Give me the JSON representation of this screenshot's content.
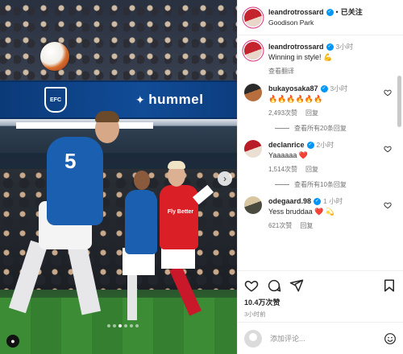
{
  "post": {
    "username": "leandrotrossard",
    "follow_state": "已关注",
    "separator": "•",
    "location": "Goodison Park",
    "photo": {
      "banner_brand": "hummel",
      "crest_text": "EFC",
      "jersey_number": "5",
      "red_shirt_text": "Fly Better",
      "carousel_dots": 6,
      "active_dot": 2
    }
  },
  "caption": {
    "username": "leandrotrossard",
    "time": "3小时",
    "text": "Winning in style! 💪",
    "translate_label": "查看翻译"
  },
  "comments": [
    {
      "username": "bukayosaka87",
      "time": "3小时",
      "text": "🔥🔥🔥🔥🔥🔥",
      "likes": "2,493次赞",
      "reply_label": "回复",
      "view_replies": "查看所有20条回复"
    },
    {
      "username": "declanrice",
      "time": "2小时",
      "text": "Yaaaaaa ❤️",
      "likes": "1,514次赞",
      "reply_label": "回复",
      "view_replies": "查看所有10条回复"
    },
    {
      "username": "odegaard.98",
      "time": "1 小时",
      "text": "Yess bruddaa ❤️ 💫",
      "likes": "621次赞",
      "reply_label": "回复",
      "view_replies": ""
    }
  ],
  "actions": {
    "likes": "10.4万次赞",
    "posted": "3小时前"
  },
  "add_comment": {
    "placeholder": "添加评论..."
  },
  "colors": {
    "verified": "#0095f6",
    "text": "#262626",
    "muted": "#8e8e8e",
    "arsenal_red": "#db1f26",
    "everton_blue": "#1b5fb0"
  }
}
